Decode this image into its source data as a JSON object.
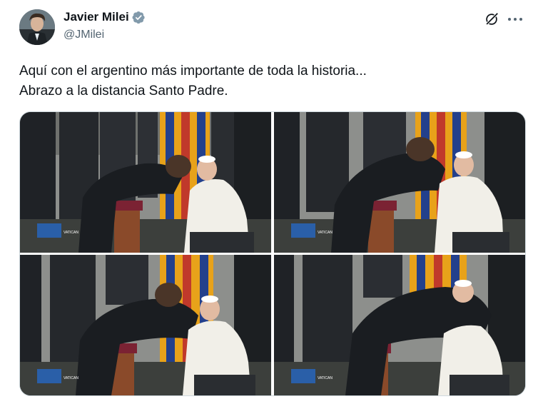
{
  "author": {
    "name": "Javier Milei",
    "handle": "@JMilei",
    "verified": true,
    "badge_color": "#1d9bf0",
    "avatar_icon": "avatar-portrait"
  },
  "header_icons": {
    "grok": "grok-icon",
    "more": "more-options-icon"
  },
  "tweet": {
    "line1": "Aquí con el argentino más importante de toda la historia...",
    "line2": "Abrazo a la distancia Santo Padre."
  },
  "media": {
    "photos": [
      {
        "watermark": "VATICAN MEDIA"
      },
      {
        "watermark": "VATICAN MEDIA"
      },
      {
        "watermark": "VATICAN MEDIA"
      },
      {
        "watermark": "VATICAN MEDIA"
      }
    ]
  },
  "colors": {
    "text_primary": "#0f1419",
    "text_secondary": "#536471",
    "border": "#cfd9de",
    "swiss_guard_yellow": "#e8a21a",
    "swiss_guard_blue": "#23408c",
    "swiss_guard_red": "#c0392b"
  }
}
